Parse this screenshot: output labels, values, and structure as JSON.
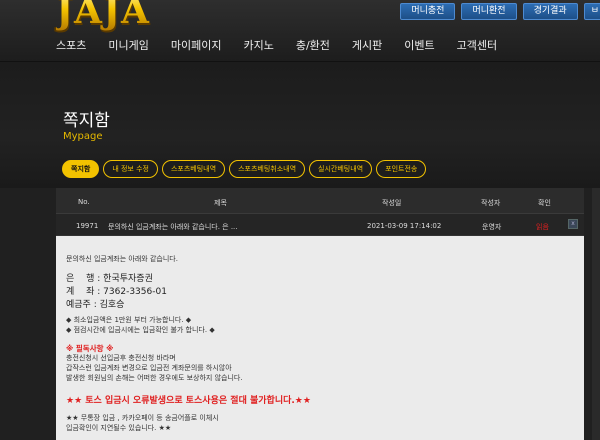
{
  "header": {
    "logo_text": "JAJA",
    "top_buttons": [
      "머니충전",
      "머니환전",
      "경기결과",
      "ㅂ"
    ],
    "nav": [
      "스포츠",
      "미니게임",
      "마이페이지",
      "카지노",
      "충/환전",
      "게시판",
      "이벤트",
      "고객센터"
    ]
  },
  "banner": {
    "title": "쪽지함",
    "subtitle": "Mypage",
    "tabs": [
      "쪽지함",
      "내 정보 수정",
      "스포츠베팅내역",
      "스포츠베팅취소내역",
      "실시간베팅내역",
      "포인트전송"
    ]
  },
  "table": {
    "headers": [
      "No.",
      "제목",
      "작성일",
      "작성자",
      "확인"
    ],
    "row": {
      "no": "19971",
      "title": "문의하신 입금계좌는 아래와 같습니다. 은 ...",
      "date": "2021-03-09 17:14:02",
      "author": "운영자",
      "status": "읽음",
      "button": "x"
    }
  },
  "message": {
    "intro": "문의하신 입금계좌는 아래와 같습니다.",
    "bank": "은 　행 : 한국투자증권",
    "account": "계 　좌 : 7362-3356-01",
    "holder": "예금주 : 김호승",
    "notice1": "◆ 최소입금액은 1만원 부터 가능합니다. ◆",
    "notice2": "◆ 점검시간에 입금시에는 입금확인 불가 합니다. ◆",
    "warn_title": "※ 필독사항 ※",
    "warn1": "충전신청시 선입금후 충전신청 바라며",
    "warn2": "갑작스런 입금계좌 변경으로 입금전 계좌문의를 하시않아",
    "warn3": "발생한 회원님의 손해는 어떠한 경우에도 보상하지 않습니다.",
    "toss_warning": "★★ 토스 입금시 오류발생으로 토스사용은 절대 불가합니다.★★",
    "footer1": "★★ 무통장 입금 , 카카오페이 등 송금어플로 이체시",
    "footer2": "입금확인이 지연될수 있습니다. ★★"
  }
}
